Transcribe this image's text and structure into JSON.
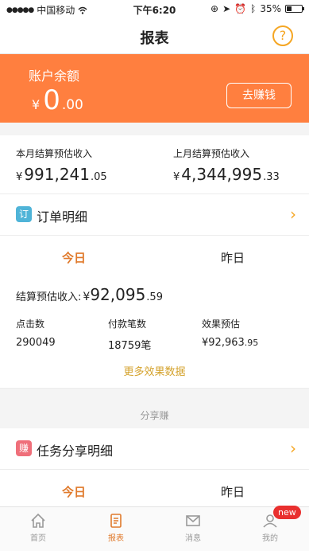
{
  "status_bar": {
    "carrier": "中国移动",
    "time": "下午6:20",
    "battery": "35%",
    "battery_level": 0.35
  },
  "nav": {
    "title": "报表",
    "help_label": "?"
  },
  "balance": {
    "label": "账户余额",
    "currency": "¥",
    "integer": "0",
    "decimal": ".00",
    "earn_button": "去赚钱"
  },
  "monthly": {
    "this_month": {
      "label": "本月结算预估收入",
      "currency": "¥",
      "integer": "991,241",
      "decimal": ".05"
    },
    "last_month": {
      "label": "上月结算预估收入",
      "currency": "¥",
      "integer": "4,344,995",
      "decimal": ".33"
    }
  },
  "orders": {
    "icon": "订",
    "title": "订单明细",
    "tabs": {
      "today": "今日",
      "yesterday": "昨日"
    },
    "estimate": {
      "label": "结算预估收入:",
      "currency": "¥",
      "integer": "92,095",
      "decimal": ".59"
    },
    "metrics": [
      {
        "label": "点击数",
        "value": "290049"
      },
      {
        "label": "付款笔数",
        "value": "18759笔"
      },
      {
        "label": "效果预估",
        "value": "¥92,963",
        "decimal": ".95"
      }
    ],
    "more_link": "更多效果数据"
  },
  "share_section": {
    "divider": "分享赚",
    "icon": "赚",
    "title": "任务分享明细",
    "tabs": {
      "today": "今日",
      "yesterday": "昨日"
    }
  },
  "tabbar": {
    "items": [
      {
        "label": "首页",
        "icon": "home-icon"
      },
      {
        "label": "报表",
        "icon": "report-icon"
      },
      {
        "label": "消息",
        "icon": "mail-icon"
      },
      {
        "label": "我的",
        "icon": "person-icon",
        "badge": "new"
      }
    ]
  },
  "colors": {
    "accent": "#ff7f3f",
    "active_tab": "#e07a2c",
    "link": "#d4a22c",
    "badge": "#e9302f"
  }
}
